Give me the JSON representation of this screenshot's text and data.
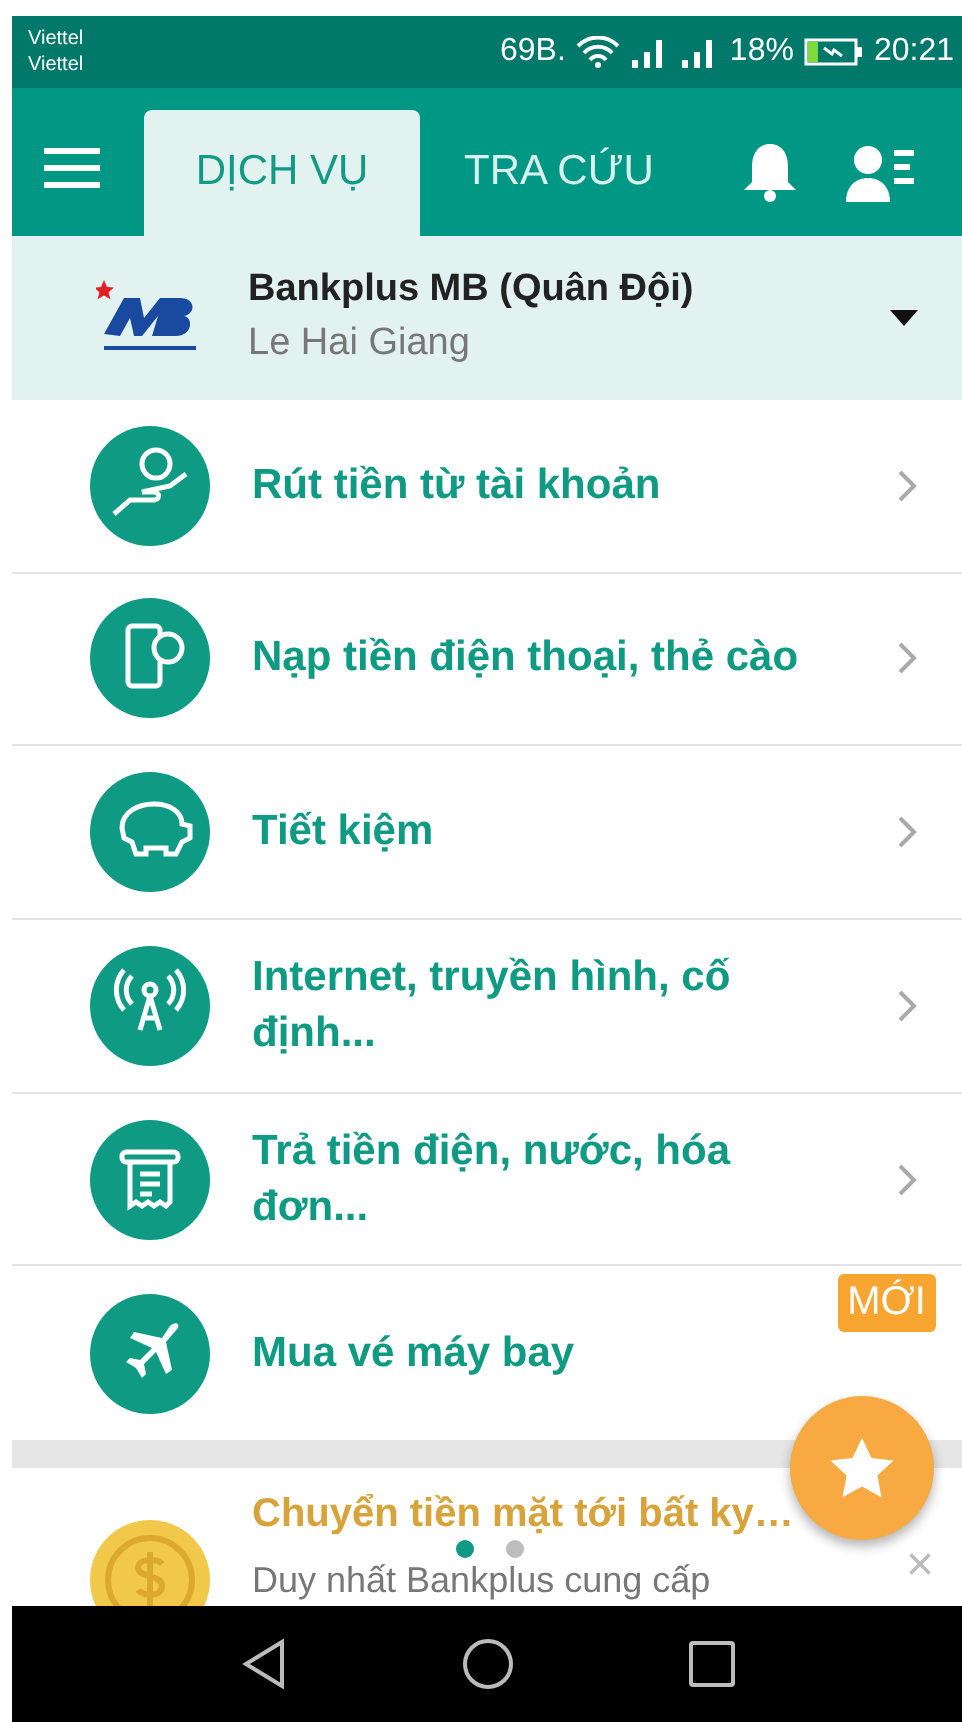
{
  "status_bar": {
    "carriers": [
      "Viettel",
      "Viettel"
    ],
    "speed": "69B.",
    "battery": "18%",
    "time": "20:21"
  },
  "tabs": [
    {
      "label": "DỊCH VỤ",
      "selected": true
    },
    {
      "label": "TRA CỨU",
      "selected": false
    }
  ],
  "account": {
    "bank": "Bankplus MB (Quân Đội)",
    "holder": "Le Hai Giang"
  },
  "services": [
    {
      "label": "Rút tiền từ tài khoản"
    },
    {
      "label": "Nạp tiền điện thoại, thẻ cào"
    },
    {
      "label": "Tiết kiệm"
    },
    {
      "label": "Internet, truyền hình, cố định..."
    },
    {
      "label": "Trả tiền điện, nước, hóa đơn..."
    },
    {
      "label": "Mua vé máy bay",
      "badge": "MỚI"
    }
  ],
  "promo": {
    "title": "Chuyển tiền mặt tới bất ky…",
    "text": "Duy nhất Bankplus cung cấp",
    "close": "×"
  },
  "pager": [
    {
      "selected": true
    },
    {
      "selected": false
    }
  ]
}
